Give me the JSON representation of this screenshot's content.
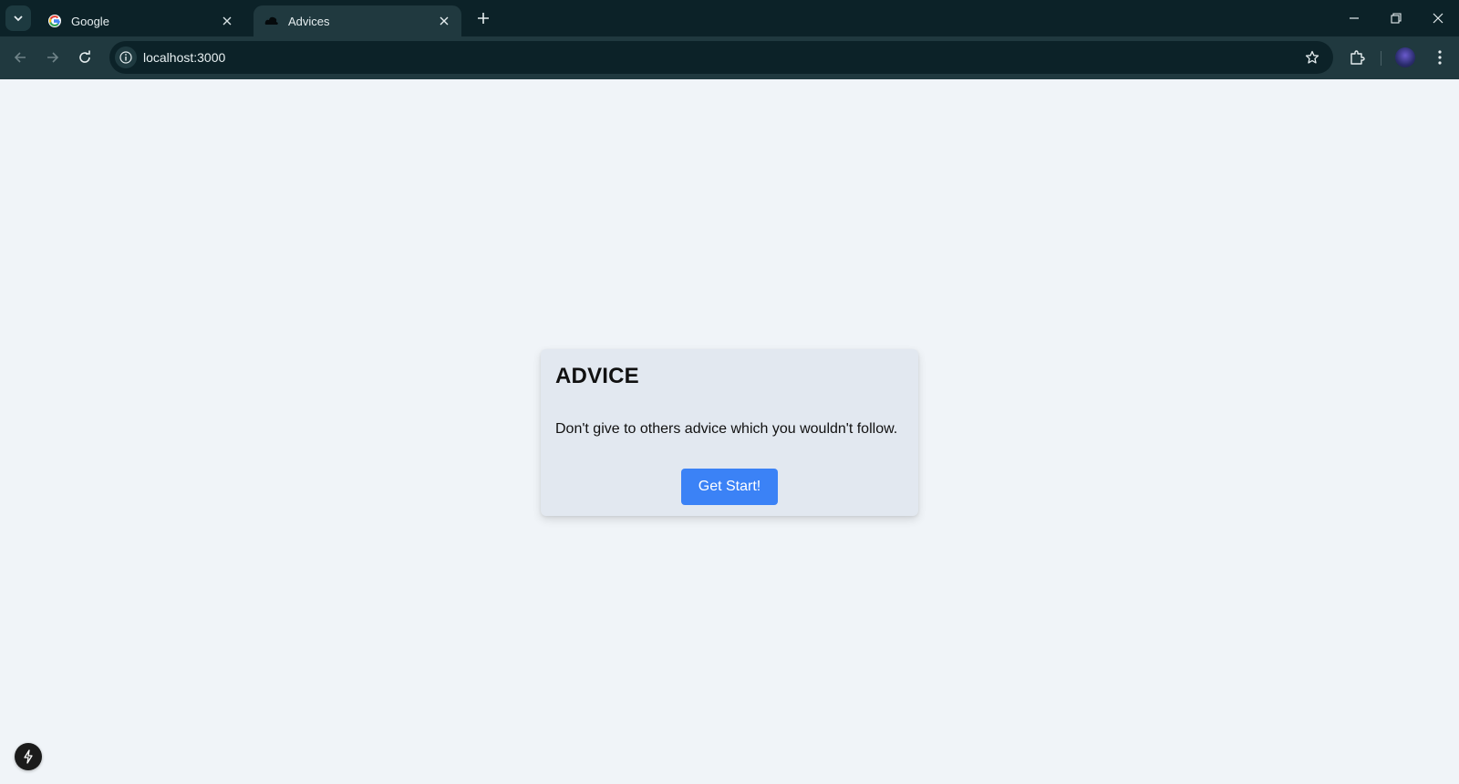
{
  "browser": {
    "tabs": [
      {
        "title": "Google",
        "icon": "google-icon",
        "active": false
      },
      {
        "title": "Advices",
        "icon": "cloud-icon",
        "active": true
      }
    ],
    "address": "localhost:3000",
    "colors": {
      "frame": "#0c2228",
      "toolbar": "#20393f"
    }
  },
  "page": {
    "card": {
      "title": "ADVICE",
      "advice": "Don't give to others advice which you wouldn't follow.",
      "button_label": "Get Start!"
    },
    "colors": {
      "background": "#f0f4f8",
      "card": "#e2e8f0",
      "button": "#3b82f6"
    }
  }
}
